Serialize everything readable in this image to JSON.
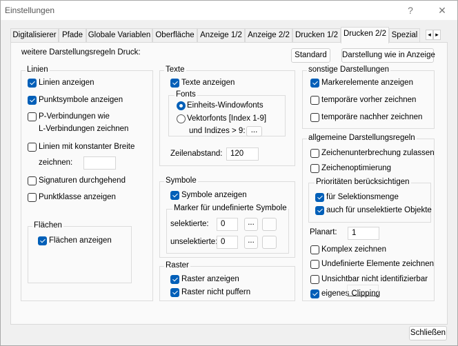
{
  "window": {
    "title": "Einstellungen",
    "help": "?",
    "close": "✕"
  },
  "tabs": [
    {
      "label": "Digitalisierer"
    },
    {
      "label": "Pfade"
    },
    {
      "label": "Globale Variablen"
    },
    {
      "label": "Oberfläche"
    },
    {
      "label": "Anzeige 1/2"
    },
    {
      "label": "Anzeige 2/2"
    },
    {
      "label": "Drucken 1/2"
    },
    {
      "label": "Drucken 2/2",
      "selected": true
    },
    {
      "label": "Spezial"
    }
  ],
  "tab_scroll": {
    "left": "◂",
    "right": "▸"
  },
  "header": {
    "label": "weitere Darstellungsregeln Druck:",
    "standard": "Standard",
    "like_display": "Darstellung wie in Anzeige"
  },
  "linien": {
    "title": "Linien",
    "items": [
      {
        "label": "Linien anzeigen",
        "checked": true
      },
      {
        "label": "Punktsymbole anzeigen",
        "checked": true
      },
      {
        "label": "P-Verbindungen wie",
        "label2": "L-Verbindungen zeichnen",
        "checked": false
      },
      {
        "label": "Linien mit konstanter Breite",
        "label2": "zeichnen:",
        "checked": false,
        "value": ""
      },
      {
        "label": "Signaturen durchgehend",
        "checked": false
      },
      {
        "label": "Punktklasse anzeigen",
        "checked": false
      }
    ],
    "flaechen": {
      "title": "Flächen",
      "item": {
        "label": "Flächen anzeigen",
        "checked": true
      }
    }
  },
  "texte": {
    "title": "Texte",
    "show": {
      "label": "Texte anzeigen",
      "checked": true
    },
    "fonts": {
      "title": "Fonts",
      "opt1": "Einheits-Windowfonts",
      "opt2": "Vektorfonts [Index 1-9]",
      "opt2b": "und Indizes > 9:",
      "selected": "Einheits-Windowfonts",
      "more": "..."
    },
    "zeilenabstand": {
      "label": "Zeilenabstand:",
      "value": "120"
    }
  },
  "symbole": {
    "title": "Symbole",
    "show": {
      "label": "Symbole anzeigen",
      "checked": true
    },
    "marker": {
      "title": "Marker für undefinierte Symbole",
      "sel_label": "selektierte:",
      "sel_value": "0",
      "unsel_label": "unselektierte:",
      "unsel_value": "0",
      "more": "..."
    }
  },
  "raster": {
    "title": "Raster",
    "items": [
      {
        "label": "Raster anzeigen",
        "checked": true
      },
      {
        "label": "Raster nicht puffern",
        "checked": true
      }
    ]
  },
  "sonstige": {
    "title": "sonstige Darstellungen",
    "items": [
      {
        "label": "Markerelemente anzeigen",
        "checked": true
      },
      {
        "label": "temporäre vorher zeichnen",
        "checked": false
      },
      {
        "label": "temporäre nachher zeichnen",
        "checked": false
      }
    ]
  },
  "allgemein": {
    "title": "allgemeine Darstellungsregeln",
    "items": [
      {
        "label": "Zeichenunterbrechung zulassen",
        "checked": false
      },
      {
        "label": "Zeichenoptimierung",
        "checked": false
      }
    ],
    "prio": {
      "title": "Prioritäten berücksichtigen",
      "items": [
        {
          "label": "für Selektionsmenge",
          "checked": true
        },
        {
          "label": "auch für unselektierte Objekte",
          "checked": true
        }
      ]
    },
    "planart": {
      "label": "Planart:",
      "value": "1"
    },
    "items2": [
      {
        "label": "Komplex zeichnen",
        "checked": false
      },
      {
        "label": "Undefinierte Elemente zeichnen",
        "checked": false
      },
      {
        "label": "Unsichtbar nicht identifizierbar",
        "checked": false
      },
      {
        "label": "eigenes Clipping",
        "checked": true
      }
    ]
  },
  "footer": {
    "close": "Schließen"
  }
}
